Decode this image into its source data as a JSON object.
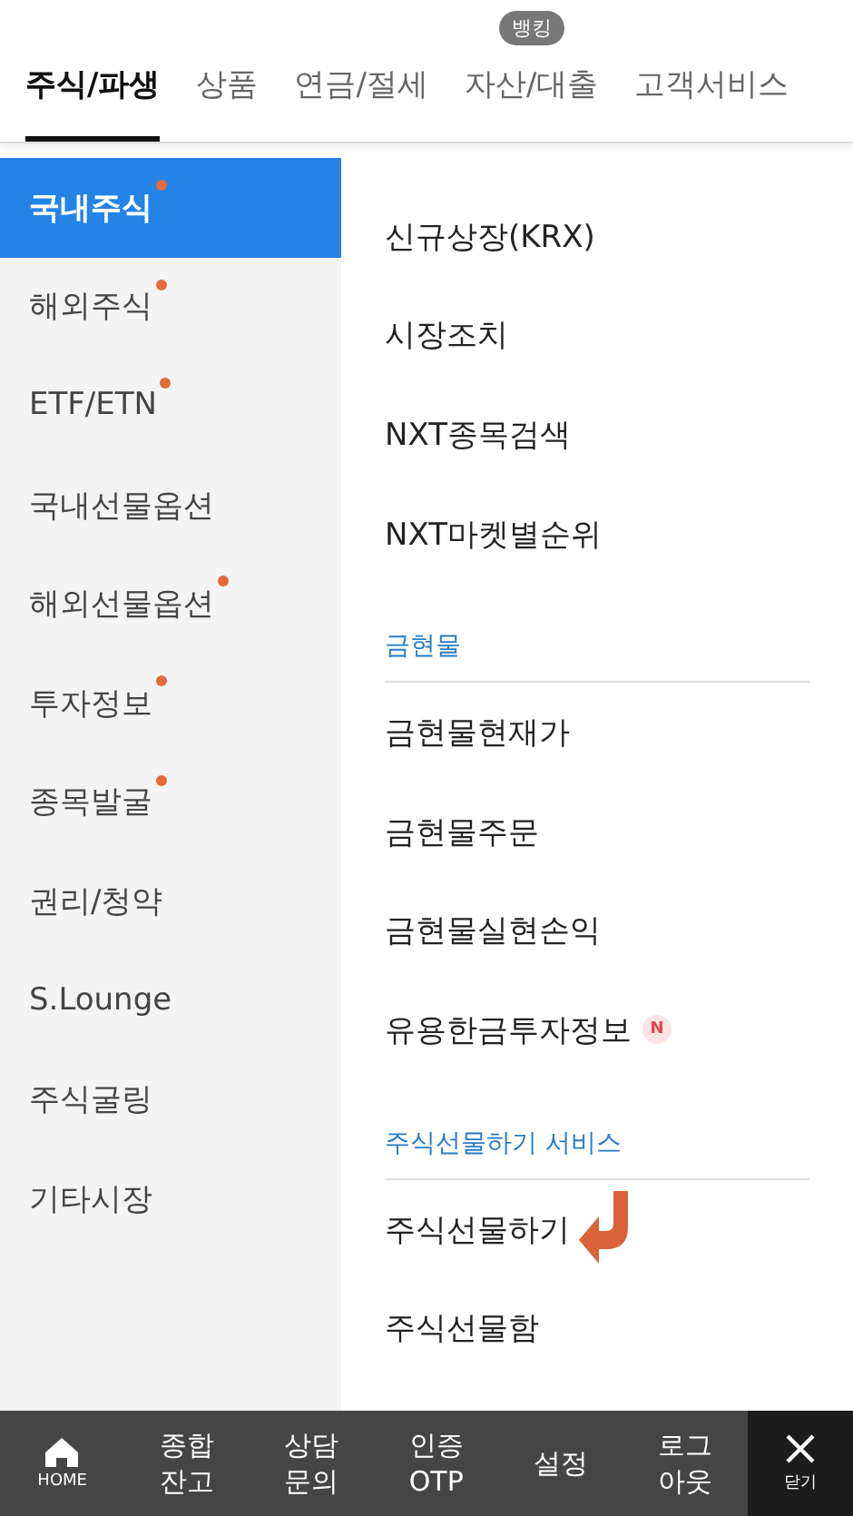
{
  "tabs": [
    {
      "label": "주식/파생",
      "selected": true
    },
    {
      "label": "상품",
      "selected": false
    },
    {
      "label": "연금/절세",
      "selected": false
    },
    {
      "label": "자산/대출",
      "selected": false,
      "badge": "뱅킹"
    },
    {
      "label": "고객서비스",
      "selected": false
    }
  ],
  "sidebar": {
    "items": [
      {
        "label": "국내주식",
        "selected": true,
        "new": true
      },
      {
        "label": "해외주식",
        "selected": false,
        "new": true
      },
      {
        "label": "ETF/ETN",
        "selected": false,
        "new": true
      },
      {
        "label": "국내선물옵션",
        "selected": false,
        "new": false
      },
      {
        "label": "해외선물옵션",
        "selected": false,
        "new": true
      },
      {
        "label": "투자정보",
        "selected": false,
        "new": true
      },
      {
        "label": "종목발굴",
        "selected": false,
        "new": true
      },
      {
        "label": "권리/청약",
        "selected": false,
        "new": false
      },
      {
        "label": "S.Lounge",
        "selected": false,
        "new": false
      },
      {
        "label": "주식굴링",
        "selected": false,
        "new": false
      },
      {
        "label": "기타시장",
        "selected": false,
        "new": false
      }
    ]
  },
  "menu": [
    {
      "kind": "item",
      "label": "신규상장(KRX)"
    },
    {
      "kind": "item",
      "label": "시장조치"
    },
    {
      "kind": "item",
      "label": "NXT종목검색"
    },
    {
      "kind": "item",
      "label": "NXT마켓별순위"
    },
    {
      "kind": "section",
      "label": "금현물"
    },
    {
      "kind": "item",
      "label": "금현물현재가"
    },
    {
      "kind": "item",
      "label": "금현물주문"
    },
    {
      "kind": "item",
      "label": "금현물실현손익"
    },
    {
      "kind": "item",
      "label": "유용한금투자정보",
      "badge": "N"
    },
    {
      "kind": "section",
      "label": "주식선물하기 서비스"
    },
    {
      "kind": "item",
      "label": "주식선물하기",
      "pointer": true
    },
    {
      "kind": "item",
      "label": "주식선물함"
    }
  ],
  "bottom_bar": [
    {
      "kind": "home",
      "lines": [
        "HOME"
      ]
    },
    {
      "kind": "text",
      "lines": [
        "종합",
        "잔고"
      ]
    },
    {
      "kind": "text",
      "lines": [
        "상담",
        "문의"
      ]
    },
    {
      "kind": "text",
      "lines": [
        "인증",
        "OTP"
      ]
    },
    {
      "kind": "text",
      "lines": [
        "설정"
      ]
    },
    {
      "kind": "text",
      "lines": [
        "로그",
        "아웃"
      ]
    },
    {
      "kind": "close",
      "lines": [
        "닫기"
      ]
    }
  ]
}
